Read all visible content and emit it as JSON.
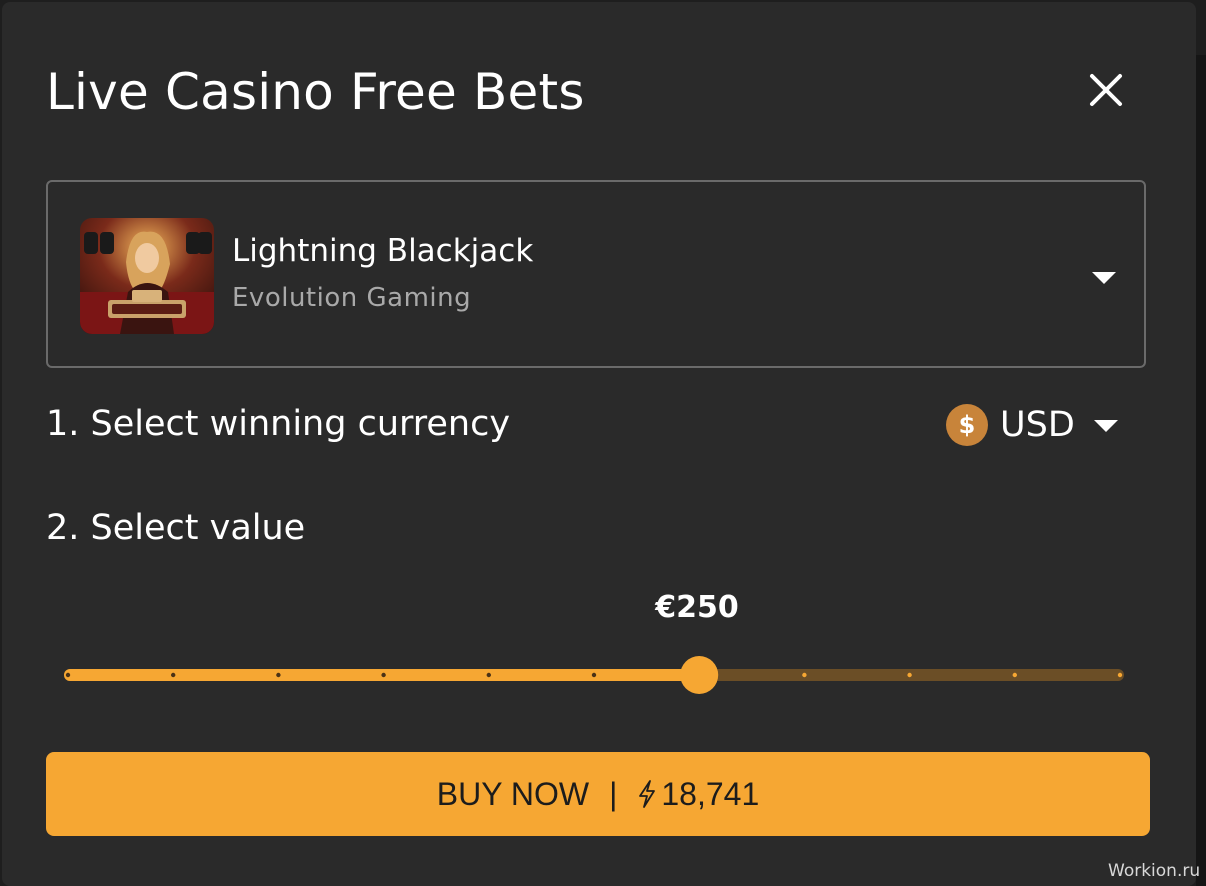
{
  "dialog": {
    "title": "Live Casino Free Bets",
    "close_icon": "close-icon"
  },
  "game": {
    "name": "Lightning Blackjack",
    "provider": "Evolution Gaming",
    "thumbnail_icon": "game-thumbnail",
    "dropdown_icon": "chevron-down-icon"
  },
  "steps": {
    "currency_label": "1. Select winning currency",
    "value_label": "2. Select value"
  },
  "currency": {
    "symbol": "$",
    "code": "USD",
    "dropdown_icon": "chevron-down-icon"
  },
  "slider": {
    "value_label": "€250",
    "position": 6,
    "steps": 10
  },
  "buy": {
    "label": "BUY NOW",
    "separator": "|",
    "price": "18,741",
    "price_icon": "lightning-icon"
  },
  "watermark": "Workion.ru",
  "colors": {
    "accent": "#f6a733",
    "track_inactive": "#6b4e26",
    "background": "#2a2a2a",
    "coin": "#c8843a"
  }
}
